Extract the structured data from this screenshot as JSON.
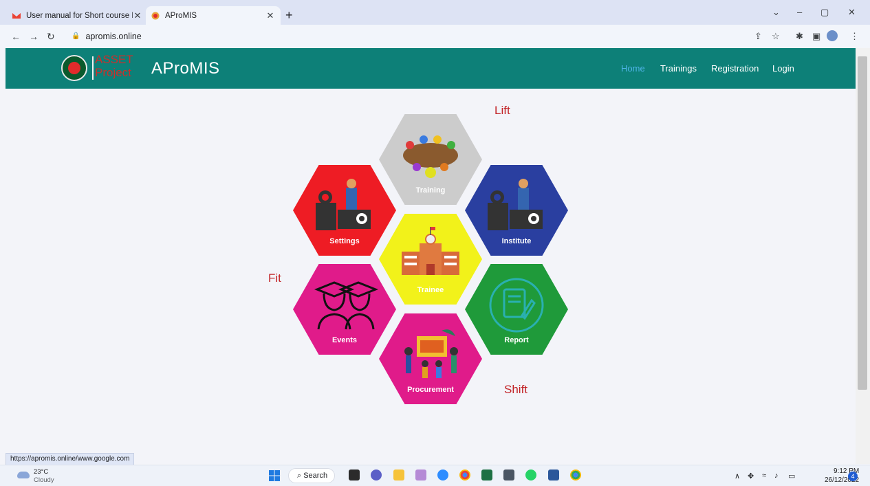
{
  "browser": {
    "tabs": [
      {
        "title": "User manual for Short course Eli",
        "active": false
      },
      {
        "title": "AProMIS",
        "active": true
      }
    ],
    "url": "apromis.online",
    "status_url": "https://apromis.online/www.google.com"
  },
  "site": {
    "logo_line1": "ASSET",
    "logo_line2": "Project",
    "brand": "AProMIS",
    "nav": [
      "Home",
      "Trainings",
      "Registration",
      "Login"
    ],
    "nav_active": "Home",
    "colors": {
      "header": "#0d8078",
      "nav_active": "#4fb4e8",
      "accent_red": "#c22226"
    }
  },
  "content": {
    "words": {
      "lift": "Lift",
      "fit": "Fit",
      "shift": "Shift"
    },
    "hexagons": [
      {
        "label": "Training",
        "color": "#cccccc"
      },
      {
        "label": "Settings",
        "color": "#ee1c24"
      },
      {
        "label": "Institute",
        "color": "#2a3fa0"
      },
      {
        "label": "Trainee",
        "color": "#f2f21a"
      },
      {
        "label": "Events",
        "color": "#e01b8a"
      },
      {
        "label": "Report",
        "color": "#1f9a3a"
      },
      {
        "label": "Procurement",
        "color": "#e01b8a"
      }
    ]
  },
  "taskbar": {
    "weather_temp": "23°C",
    "weather_cond": "Cloudy",
    "search": "Search",
    "time": "9:12 PM",
    "date": "26/12/2022",
    "notifications": "4"
  }
}
